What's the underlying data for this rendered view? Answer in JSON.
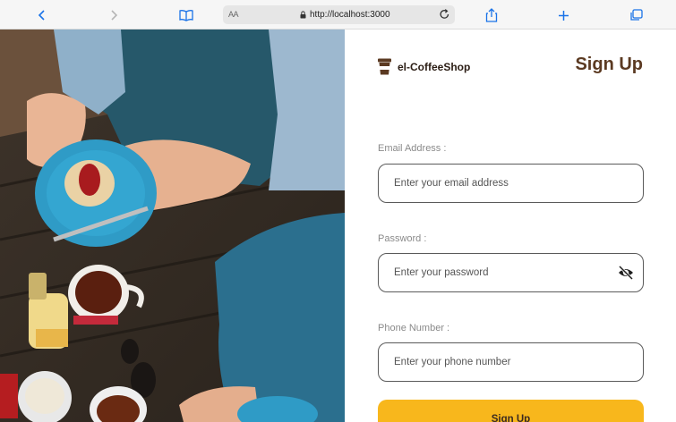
{
  "browser": {
    "text_size_label": "AA",
    "url": "http://localhost:3000",
    "icons": [
      "back-icon",
      "forward-icon",
      "bookmarks-icon",
      "lock-icon",
      "reload-icon",
      "share-icon",
      "new-tab-icon",
      "tabs-icon"
    ]
  },
  "brand": {
    "name": "el-CoffeeShop",
    "icon": "coffee-cup-icon"
  },
  "form": {
    "title": "Sign Up",
    "email": {
      "label": "Email Address :",
      "placeholder": "Enter your email address"
    },
    "password": {
      "label": "Password :",
      "placeholder": "Enter your password",
      "toggle_icon": "eye-slash-icon"
    },
    "phone": {
      "label": "Phone Number :",
      "placeholder": "Enter your phone number"
    },
    "submit_label": "Sign Up"
  },
  "colors": {
    "accent": "#f8b71c",
    "title": "#5b3a22",
    "input_border": "#5a5a5a"
  }
}
